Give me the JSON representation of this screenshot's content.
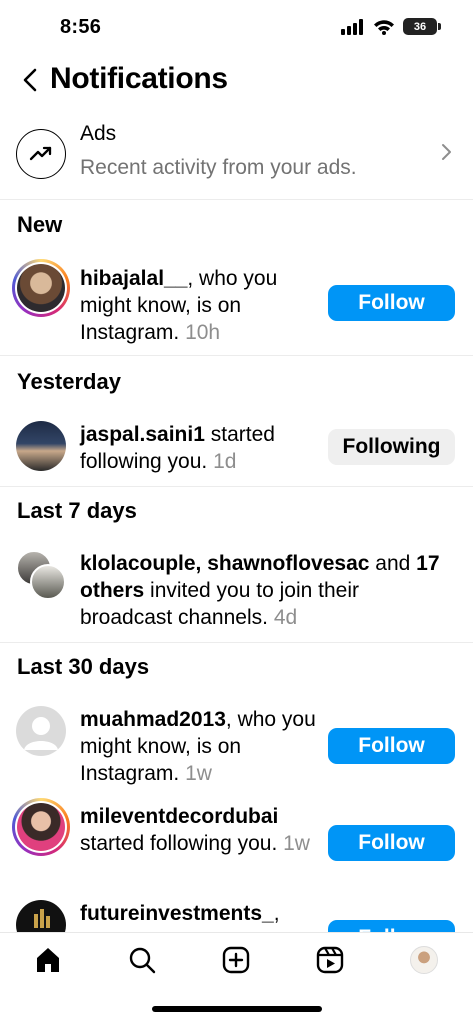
{
  "status_bar": {
    "time": "8:56",
    "battery": "36"
  },
  "header": {
    "title": "Notifications"
  },
  "ads": {
    "title": "Ads",
    "subtitle": "Recent activity from your ads."
  },
  "sections": {
    "new": "New",
    "yesterday": "Yesterday",
    "last7": "Last 7 days",
    "last30": "Last 30 days"
  },
  "notifications": [
    {
      "username": "hibajalal__",
      "text": ", who you might know, is on Instagram.",
      "time": "10h",
      "button": "Follow"
    },
    {
      "username": "jaspal.saini1",
      "text": " started following you.",
      "time": "1d",
      "button": "Following"
    },
    {
      "username": "klolacouple",
      "sep1": ", ",
      "username2": "shawnoflovesac",
      "sep2": " and ",
      "others": "17 others",
      "text": " invited you to join their broadcast channels.",
      "time": "4d"
    },
    {
      "username": "muahmad2013",
      "text": ", who you might know, is on Instagram.",
      "time": "1w",
      "button": "Follow"
    },
    {
      "username": "mileventdecordubai",
      "text": " started following you.",
      "time": "1w",
      "button": "Follow"
    },
    {
      "username": "futureinvestments_",
      "text": ",",
      "button": "Follow"
    }
  ],
  "tab_bar": [
    "home-icon",
    "search-icon",
    "create-icon",
    "reels-icon",
    "profile-avatar"
  ],
  "colors": {
    "accent": "#0095f6",
    "muted": "#737373"
  }
}
